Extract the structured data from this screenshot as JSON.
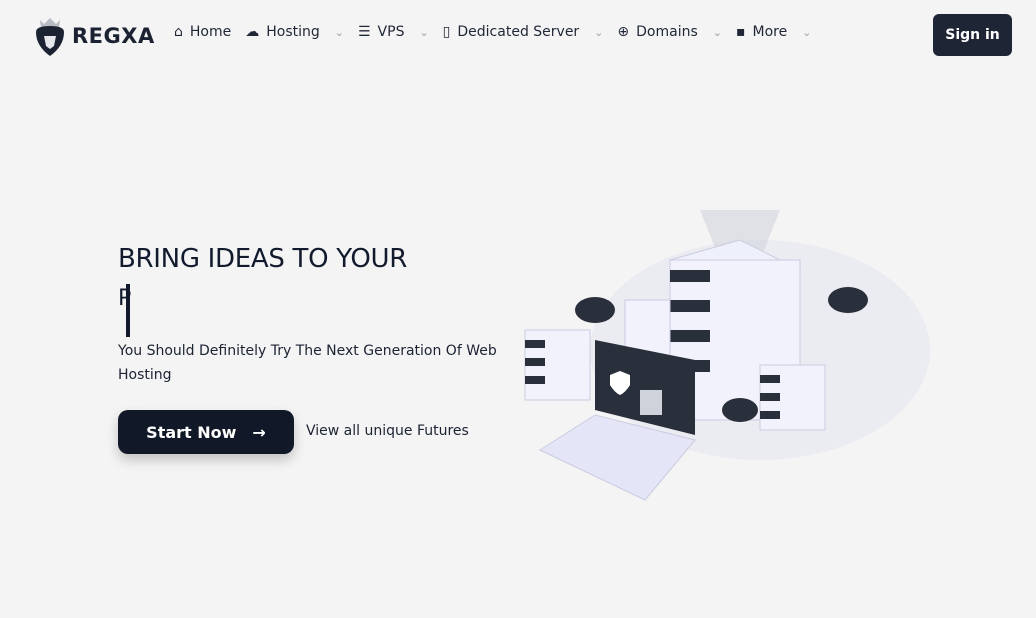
{
  "brand": {
    "name": "REGXA"
  },
  "nav": {
    "items": [
      {
        "label": "Home",
        "icon": "home-icon",
        "dropdown": false
      },
      {
        "label": "Hosting",
        "icon": "cloud-icon",
        "dropdown": true
      },
      {
        "label": "VPS",
        "icon": "server-icon",
        "dropdown": true
      },
      {
        "label": "Dedicated Server",
        "icon": "server-tower-icon",
        "dropdown": true
      },
      {
        "label": "Domains",
        "icon": "globe-icon",
        "dropdown": true
      },
      {
        "label": "More",
        "icon": "more-icon",
        "dropdown": true
      }
    ],
    "signin": "Sign in"
  },
  "hero": {
    "title": "BRING IDEAS TO YOUR",
    "typed": "P",
    "subtitle": "You Should Definitely Try The Next Generation Of Web Hosting",
    "start": "Start Now",
    "view_link": "View all unique Futures"
  },
  "colors": {
    "primary": "#111827",
    "background": "#f4f4f4"
  }
}
